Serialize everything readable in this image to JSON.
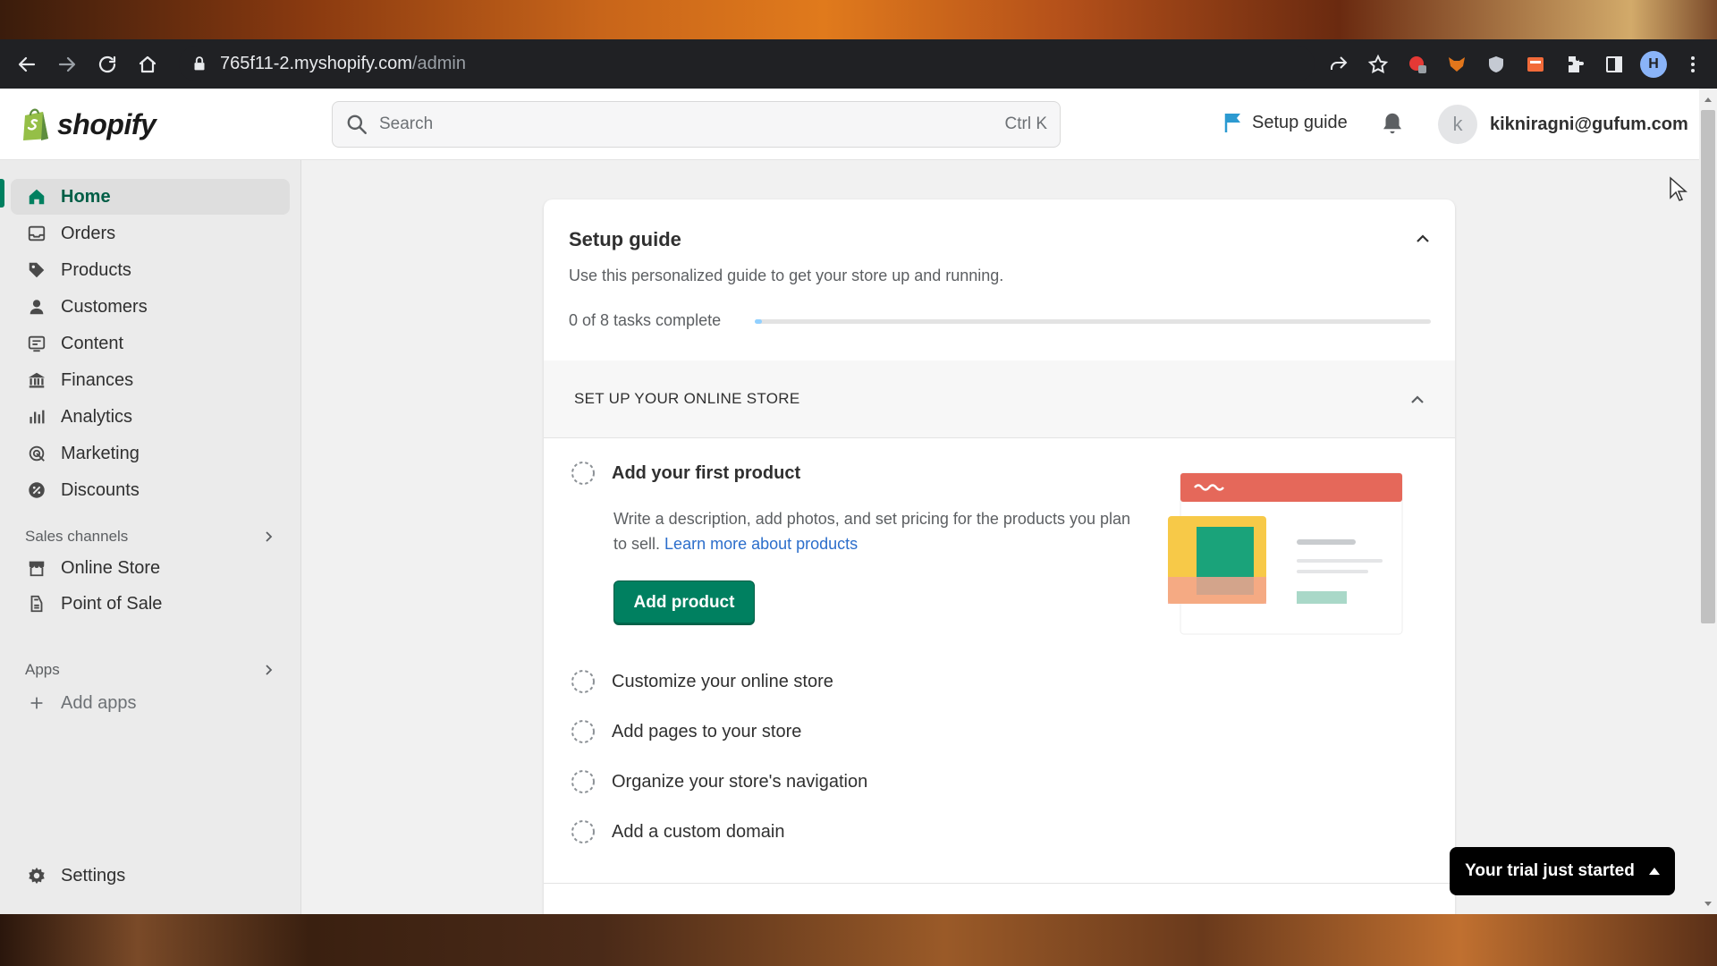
{
  "browser": {
    "url_host": "765f11-2.myshopify.com",
    "url_path": "/admin",
    "profile_initial": "H"
  },
  "header": {
    "logo_text": "shopify",
    "search_placeholder": "Search",
    "search_shortcut": "Ctrl K",
    "setup_guide_label": "Setup guide",
    "avatar_initial": "k",
    "account_email": "kikniragni@gufum.com"
  },
  "sidebar": {
    "items": [
      {
        "label": "Home",
        "icon": "home-icon"
      },
      {
        "label": "Orders",
        "icon": "orders-icon"
      },
      {
        "label": "Products",
        "icon": "tag-icon"
      },
      {
        "label": "Customers",
        "icon": "person-icon"
      },
      {
        "label": "Content",
        "icon": "content-icon"
      },
      {
        "label": "Finances",
        "icon": "bank-icon"
      },
      {
        "label": "Analytics",
        "icon": "bar-chart-icon"
      },
      {
        "label": "Marketing",
        "icon": "target-icon"
      },
      {
        "label": "Discounts",
        "icon": "discount-icon"
      }
    ],
    "sales_channels_label": "Sales channels",
    "sales_channels": [
      {
        "label": "Online Store",
        "icon": "store-icon"
      },
      {
        "label": "Point of Sale",
        "icon": "pos-icon"
      }
    ],
    "apps_label": "Apps",
    "add_apps_label": "Add apps",
    "settings_label": "Settings"
  },
  "setup_guide": {
    "title": "Setup guide",
    "subtitle": "Use this personalized guide to get your store up and running.",
    "progress_text": "0 of 8 tasks complete",
    "progress_fraction": 0,
    "section_title": "SET UP YOUR ONLINE STORE",
    "expanded_task": {
      "label": "Add your first product",
      "description": "Write a description, add photos, and set pricing for the products you plan to sell.",
      "link_text": "Learn more about products",
      "button_label": "Add product"
    },
    "tasks": [
      "Customize your online store",
      "Add pages to your store",
      "Organize your store's navigation",
      "Add a custom domain"
    ]
  },
  "trial_banner": {
    "label": "Your trial just started"
  },
  "colors": {
    "brand_green": "#008060",
    "active_nav_text": "#005e46",
    "link_blue": "#2c6ecb",
    "setup_flag": "#2c9ad1"
  }
}
